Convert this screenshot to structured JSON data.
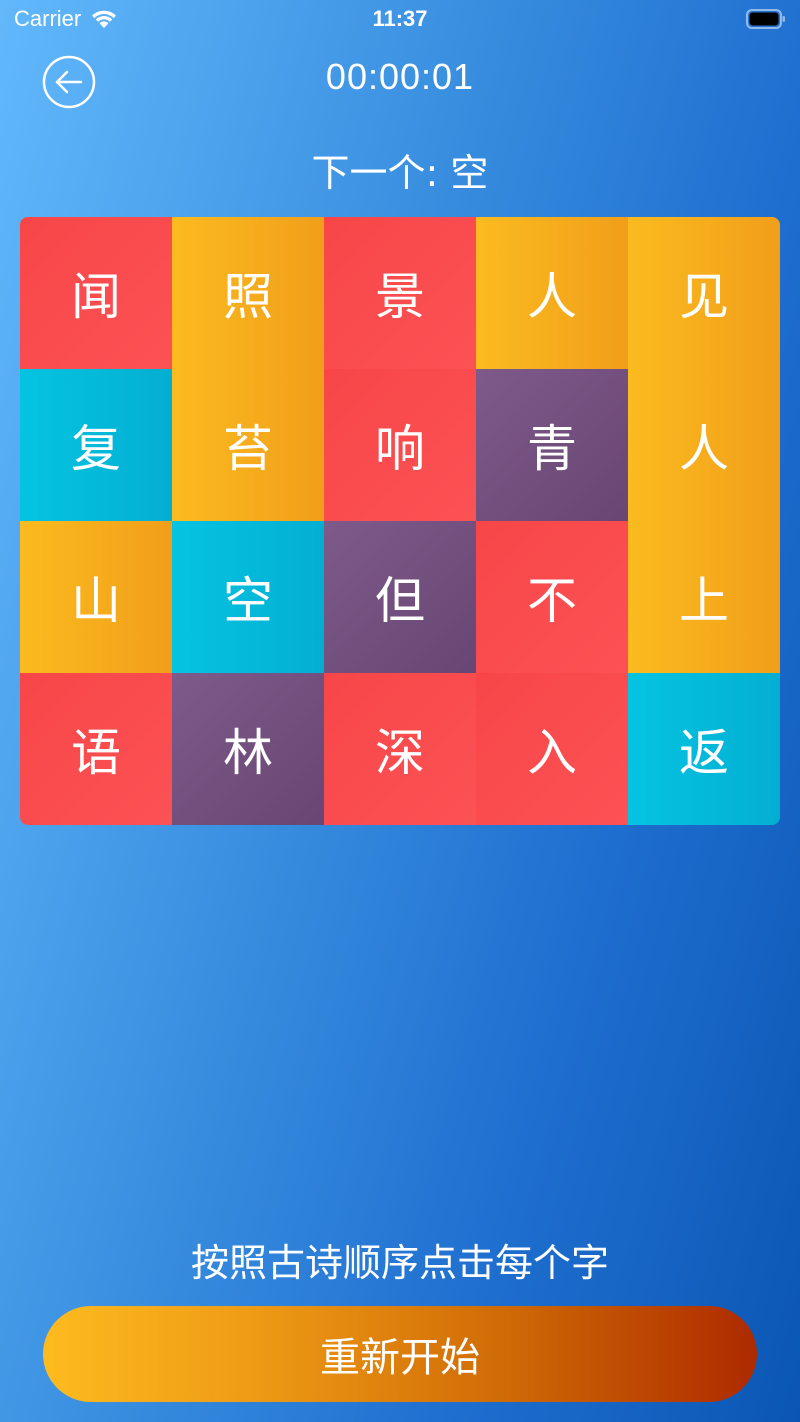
{
  "status_bar": {
    "carrier": "Carrier",
    "time": "11:37"
  },
  "header": {
    "back_icon": "back-arrow-circle-icon",
    "timer": "00:00:01"
  },
  "next_hint": "下一个: 空",
  "tile_colors": {
    "red": "#f84648",
    "yellow": "#fbbb1f",
    "cyan": "#05c4e1",
    "purple": "#7d5a8a"
  },
  "board": {
    "tiles": [
      {
        "char": "闻",
        "color": "red"
      },
      {
        "char": "照",
        "color": "yellow"
      },
      {
        "char": "景",
        "color": "red"
      },
      {
        "char": "人",
        "color": "yellow"
      },
      {
        "char": "见",
        "color": "yellow"
      },
      {
        "char": "复",
        "color": "cyan"
      },
      {
        "char": "苔",
        "color": "yellow"
      },
      {
        "char": "响",
        "color": "red"
      },
      {
        "char": "青",
        "color": "purple"
      },
      {
        "char": "人",
        "color": "yellow"
      },
      {
        "char": "山",
        "color": "yellow"
      },
      {
        "char": "空",
        "color": "cyan"
      },
      {
        "char": "但",
        "color": "purple"
      },
      {
        "char": "不",
        "color": "red"
      },
      {
        "char": "上",
        "color": "yellow"
      },
      {
        "char": "语",
        "color": "red"
      },
      {
        "char": "林",
        "color": "purple"
      },
      {
        "char": "深",
        "color": "red"
      },
      {
        "char": "入",
        "color": "red"
      },
      {
        "char": "返",
        "color": "cyan"
      }
    ]
  },
  "instruction": "按照古诗顺序点击每个字",
  "restart_label": "重新开始"
}
